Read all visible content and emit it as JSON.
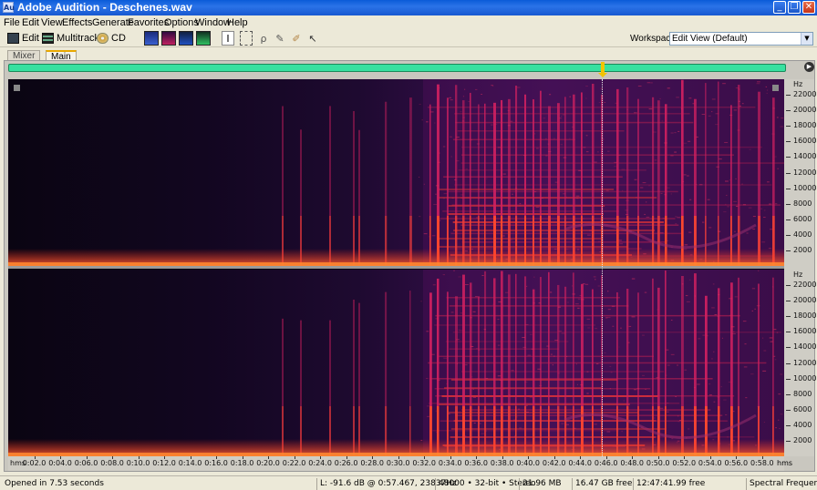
{
  "window": {
    "title": "Adobe Audition - Deschenes.wav",
    "app_icon": "Au"
  },
  "menu": [
    "File",
    "Edit",
    "View",
    "Effects",
    "Generate",
    "Favorites",
    "Options",
    "Window",
    "Help"
  ],
  "toolbar": {
    "edit_label": "Edit",
    "multitrack_label": "Multitrack",
    "cd_label": "CD",
    "workspace_label": "Workspace:",
    "workspace_value": "Edit View (Default)"
  },
  "tabs": {
    "mixer": "Mixer",
    "main": "Main"
  },
  "frequency_axis": {
    "unit": "Hz",
    "labels": [
      "22000",
      "20000",
      "18000",
      "16000",
      "14000",
      "12000",
      "10000",
      "8000",
      "6000",
      "4000",
      "2000"
    ]
  },
  "time_axis": {
    "unit": "hms",
    "labels": [
      "0:02.0",
      "0:04.0",
      "0:06.0",
      "0:08.0",
      "0:10.0",
      "0:12.0",
      "0:14.0",
      "0:16.0",
      "0:18.0",
      "0:20.0",
      "0:22.0",
      "0:24.0",
      "0:26.0",
      "0:28.0",
      "0:30.0",
      "0:32.0",
      "0:34.0",
      "0:36.0",
      "0:38.0",
      "0:40.0",
      "0:42.0",
      "0:44.0",
      "0:46.0",
      "0:48.0",
      "0:50.0",
      "0:52.0",
      "0:54.0",
      "0:56.0",
      "0:58.0"
    ]
  },
  "status": {
    "opened": "Opened in 7.53 seconds",
    "cursor": "L: -91.6 dB @  0:57.467, 23837Hz",
    "format": "48000 • 32-bit • Stereo",
    "size": "21.96 MB",
    "free_space": "16.47 GB free",
    "free_time": "12:47:41.99 free",
    "view_mode": "Spectral Frequency"
  },
  "playhead_time": "0:46.0",
  "colors": {
    "spectrum_low": "#0a0512",
    "spectrum_mid": "#5a1060",
    "spectrum_high": "#ff3020",
    "overview": "#38e0a0"
  }
}
